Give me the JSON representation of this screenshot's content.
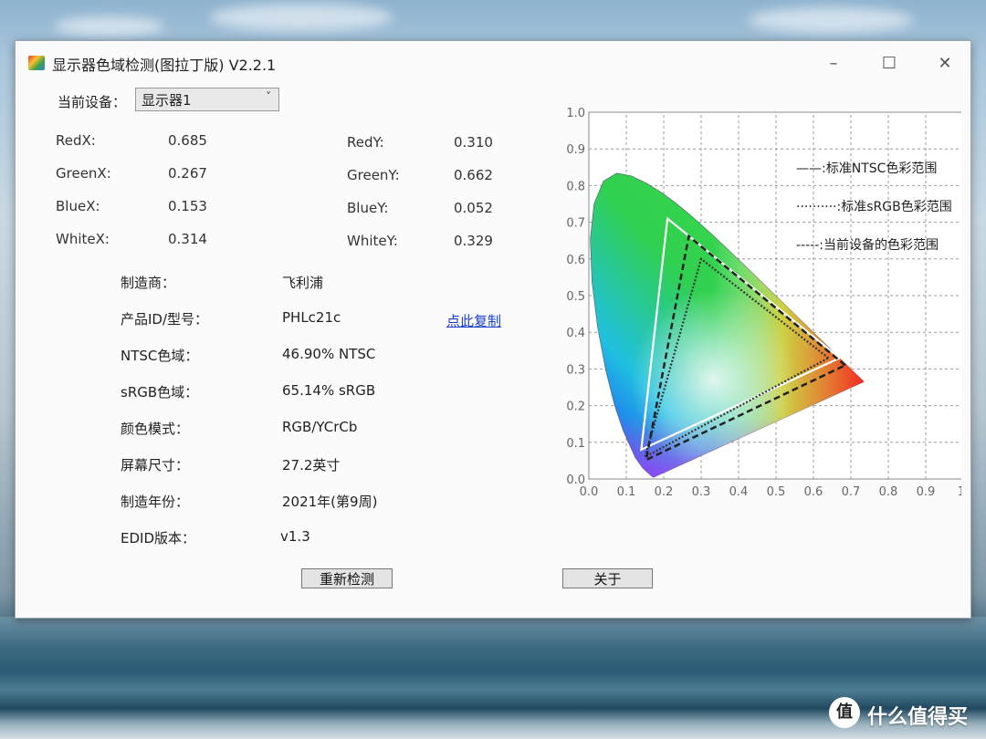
{
  "window": {
    "title": "显示器色域检测(图拉丁版) V2.2.1",
    "minimize": "–",
    "maximize": "☐",
    "close": "✕"
  },
  "device": {
    "label": "当前设备：",
    "selected": "显示器1"
  },
  "coords": {
    "red_x_label": "RedX:",
    "red_x": "0.685",
    "green_x_label": "GreenX:",
    "green_x": "0.267",
    "blue_x_label": "BlueX:",
    "blue_x": "0.153",
    "white_x_label": "WhiteX:",
    "white_x": "0.314",
    "red_y_label": "RedY:",
    "red_y": "0.310",
    "green_y_label": "GreenY:",
    "green_y": "0.662",
    "blue_y_label": "BlueY:",
    "blue_y": "0.052",
    "white_y_label": "WhiteY:",
    "white_y": "0.329"
  },
  "info": {
    "manufacturer_label": "制造商：",
    "manufacturer": "飞利浦",
    "product_label": "产品ID/型号：",
    "product": "PHLc21c",
    "copy_link": "点此复制",
    "ntsc_label": "NTSC色域：",
    "ntsc": "46.90% NTSC",
    "srgb_label": "sRGB色域：",
    "srgb": "65.14% sRGB",
    "color_mode_label": "颜色模式：",
    "color_mode": "RGB/YCrCb",
    "screen_size_label": "屏幕尺寸：",
    "screen_size": "27.2英寸",
    "year_label": "制造年份：",
    "year": "2021年(第9周)",
    "edid_label": "EDID版本：",
    "edid": "v1.3"
  },
  "buttons": {
    "redetect": "重新检测",
    "about": "关于"
  },
  "chart_data": {
    "type": "scatter",
    "title": "",
    "xlabel": "",
    "ylabel": "",
    "xlim": [
      0,
      1
    ],
    "ylim": [
      0,
      1
    ],
    "x_ticks": [
      "0.0",
      "0.1",
      "0.2",
      "0.3",
      "0.4",
      "0.5",
      "0.6",
      "0.7",
      "0.8",
      "0.9",
      "1."
    ],
    "y_ticks": [
      "0.0",
      "0.1",
      "0.2",
      "0.3",
      "0.4",
      "0.5",
      "0.6",
      "0.7",
      "0.8",
      "0.9",
      "1.0"
    ],
    "grid": true,
    "legend_placement": "top-right",
    "series": [
      {
        "name": "——:标准NTSC色彩范围",
        "style": "solid",
        "color": "#ffffff",
        "points": [
          [
            0.67,
            0.33
          ],
          [
            0.21,
            0.71
          ],
          [
            0.14,
            0.08
          ]
        ]
      },
      {
        "name": "··········:标准sRGB色彩范围",
        "style": "dotted",
        "color": "#333333",
        "points": [
          [
            0.64,
            0.33
          ],
          [
            0.3,
            0.6
          ],
          [
            0.15,
            0.06
          ]
        ]
      },
      {
        "name": "-----:当前设备的色彩范围",
        "style": "dashed",
        "color": "#222222",
        "points": [
          [
            0.685,
            0.31
          ],
          [
            0.267,
            0.662
          ],
          [
            0.153,
            0.052
          ]
        ]
      }
    ],
    "white_point": [
      0.314,
      0.329
    ]
  },
  "watermark": {
    "logo": "值",
    "text": "什么值得买"
  }
}
